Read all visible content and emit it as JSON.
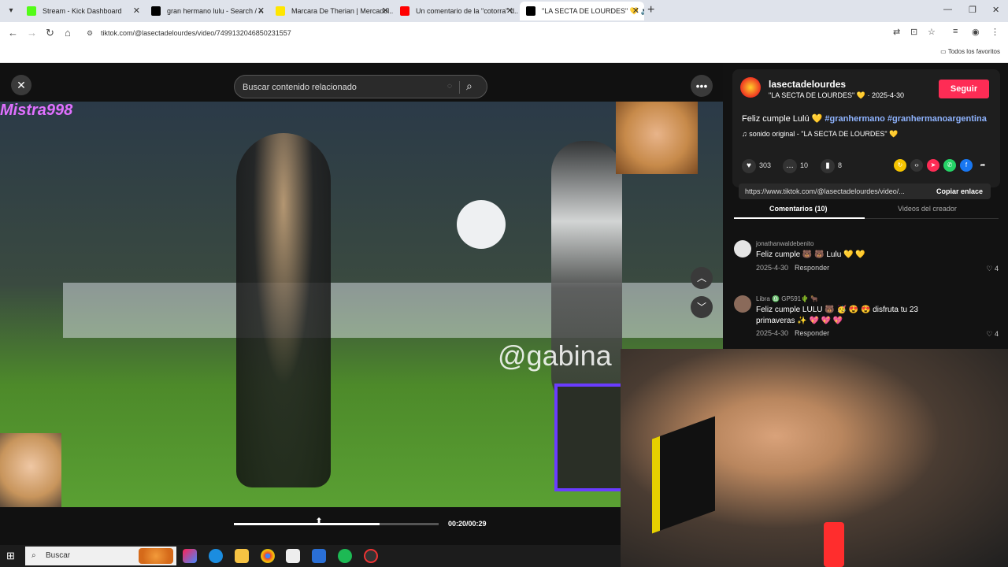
{
  "tabs": [
    {
      "title": "Stream - Kick Dashboard",
      "color": "#53fc18",
      "active": false
    },
    {
      "title": "gran hermano lulu - Search / X",
      "color": "#000000",
      "active": false
    },
    {
      "title": "Marcara De Therian | Mercadol...",
      "color": "#ffe600",
      "active": false
    },
    {
      "title": "Un comentario de la \"cotorra\" d...",
      "color": "#ff0000",
      "active": false
    },
    {
      "title": "\"LA SECTA DE LOURDES\" 💛 🔊",
      "color": "#000000",
      "active": true
    }
  ],
  "address_bar": {
    "url": "tiktok.com/@lasectadelourdes/video/7499132046850231557"
  },
  "bookmarks": {
    "all_label": "Todos los favoritos"
  },
  "player": {
    "search_placeholder": "Buscar contenido relacionado",
    "watermark": "@gabina",
    "overlay_text": "Mistra998",
    "time": "00:20/00:29",
    "progress": 0.71
  },
  "creator": {
    "username": "lasectadelourdes",
    "nickname": "\"LA SECTA DE LOURDES\" 💛 · 2025-4-30",
    "follow_label": "Seguir",
    "description_prefix": "Feliz cumple Lulú 💛",
    "hashtags": "#granhermano #granhermanoargentina",
    "sound": "♫  sonido original - \"LA SECTA DE LOURDES\" 💛",
    "likes": "303",
    "comments": "10",
    "saves": "8",
    "link": "https://www.tiktok.com/@lasectadelourdes/video/...",
    "copy_label": "Copiar enlace"
  },
  "side_tabs": {
    "comments": "Comentarios (10)",
    "creator_videos": "Videos del creador"
  },
  "comments": [
    {
      "name": "jonathanwaldebenito",
      "text": "Feliz cumple 🐻 🐻 Lulu 💛 💛",
      "date": "2025-4-30",
      "reply": "Responder",
      "likes": "4"
    },
    {
      "name": "Libra ♎ GP591🌵 🐂",
      "text": "Feliz cumple LULU 🐻 🥳 😍 😍 disfruta tu 23 primaveras ✨ 💖 💖 💖",
      "date": "2025-4-30",
      "reply": "Responder",
      "likes": "4"
    }
  ],
  "taskbar": {
    "search_label": "Buscar"
  }
}
